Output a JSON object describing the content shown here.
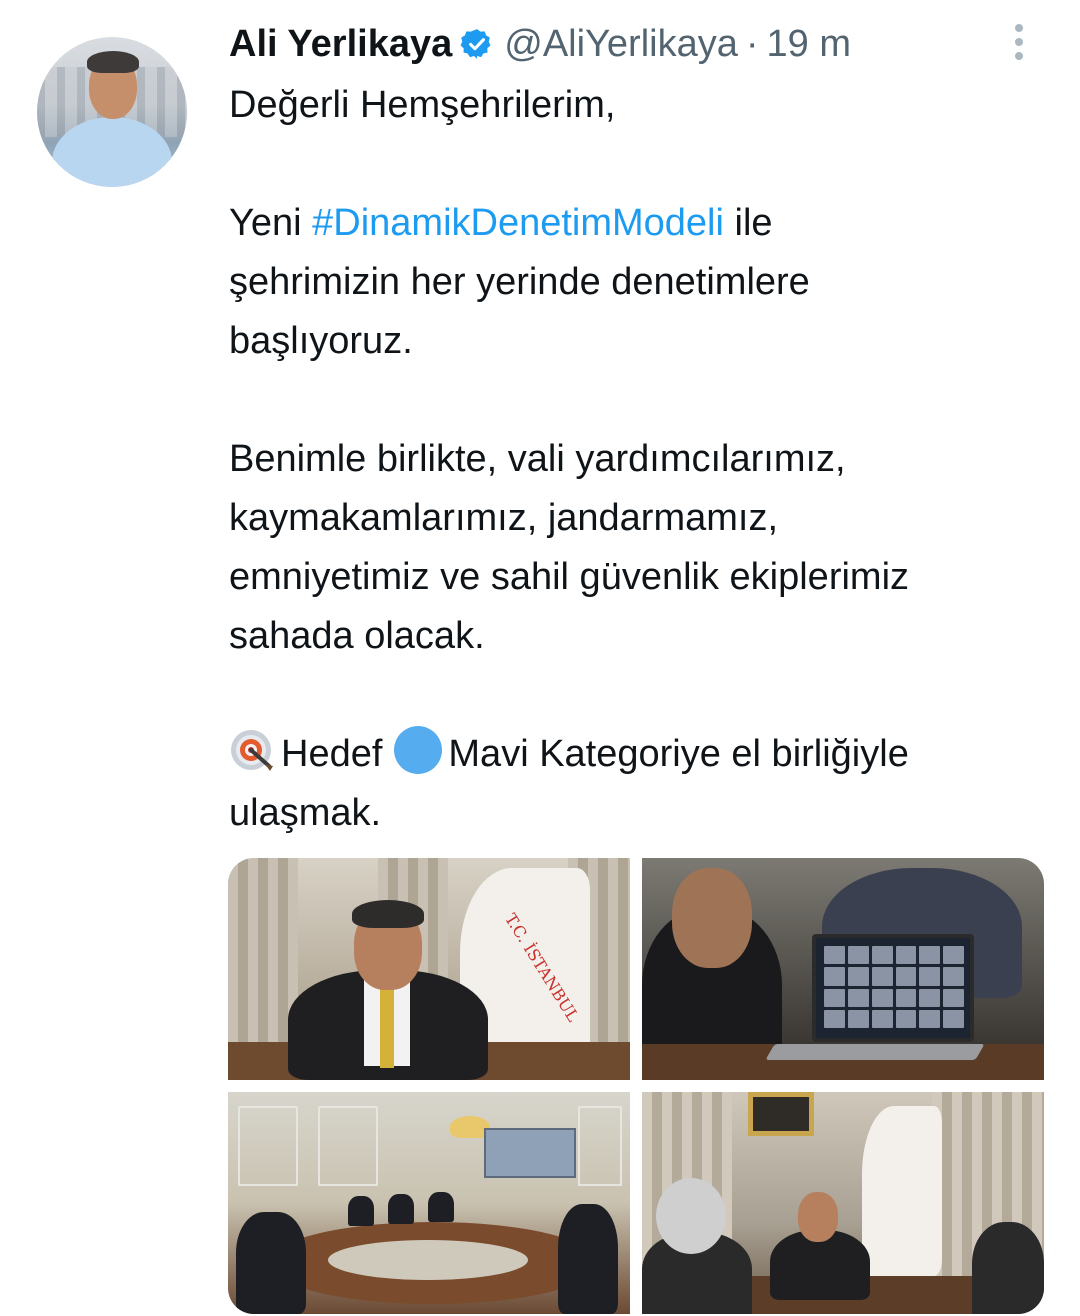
{
  "tweet": {
    "author_name": "Ali Yerlikaya",
    "handle": "@AliYerlikaya",
    "separator": "·",
    "timestamp": "19 m",
    "paragraphs": {
      "p1": "Değerli Hemşehrilerim,",
      "p2_before": "Yeni ",
      "p2_hashtag": "#DinamikDenetimModeli",
      "p2_line1_after": " ile",
      "p2_line2": "şehrimizin her yerinde denetimlere",
      "p2_line3": "başlıyoruz.",
      "p3_line1": "Benimle birlikte, vali yardımcılarımız,",
      "p3_line2": "kaymakamlarımız, jandarmamız,",
      "p3_line3": "emniyetimiz ve sahil güvenlik ekiplerimiz",
      "p3_line4": "sahada olacak.",
      "p4_hedef": "Hedef",
      "p4_mavi": "Mavi Kategoriye el birliğiyle",
      "p4_line2": "ulaşmak."
    },
    "icons": {
      "verified": "verified-badge-icon",
      "more": "more-vertical-icon",
      "target_emoji": "direct-hit-emoji",
      "blue_circle_emoji": "blue-circle-emoji"
    },
    "colors": {
      "hashtag": "#1d9bf0",
      "secondary_text": "#536471",
      "verified": "#1d9bf0",
      "blue_circle": "#55acee"
    },
    "media": {
      "flag_text": "T.C. İSTANBUL"
    }
  }
}
